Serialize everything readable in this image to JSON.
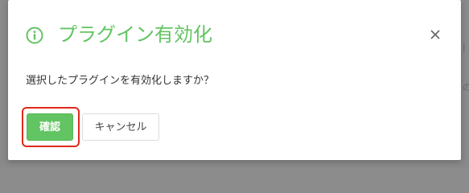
{
  "dialog": {
    "title": "プラグイン有効化",
    "message": "選択したプラグインを有効化しますか？",
    "confirm_label": "確認",
    "cancel_label": "キャンセル",
    "close_symbol": "×",
    "title_icon": "info-circle-icon",
    "close_icon": "close-icon"
  },
  "background": {
    "peek_top": "|",
    "peek_bottom": "の"
  },
  "colors": {
    "accent": "#62c462",
    "highlight": "#e0281c",
    "text": "#333333",
    "backdrop": "#8a8a8a"
  }
}
